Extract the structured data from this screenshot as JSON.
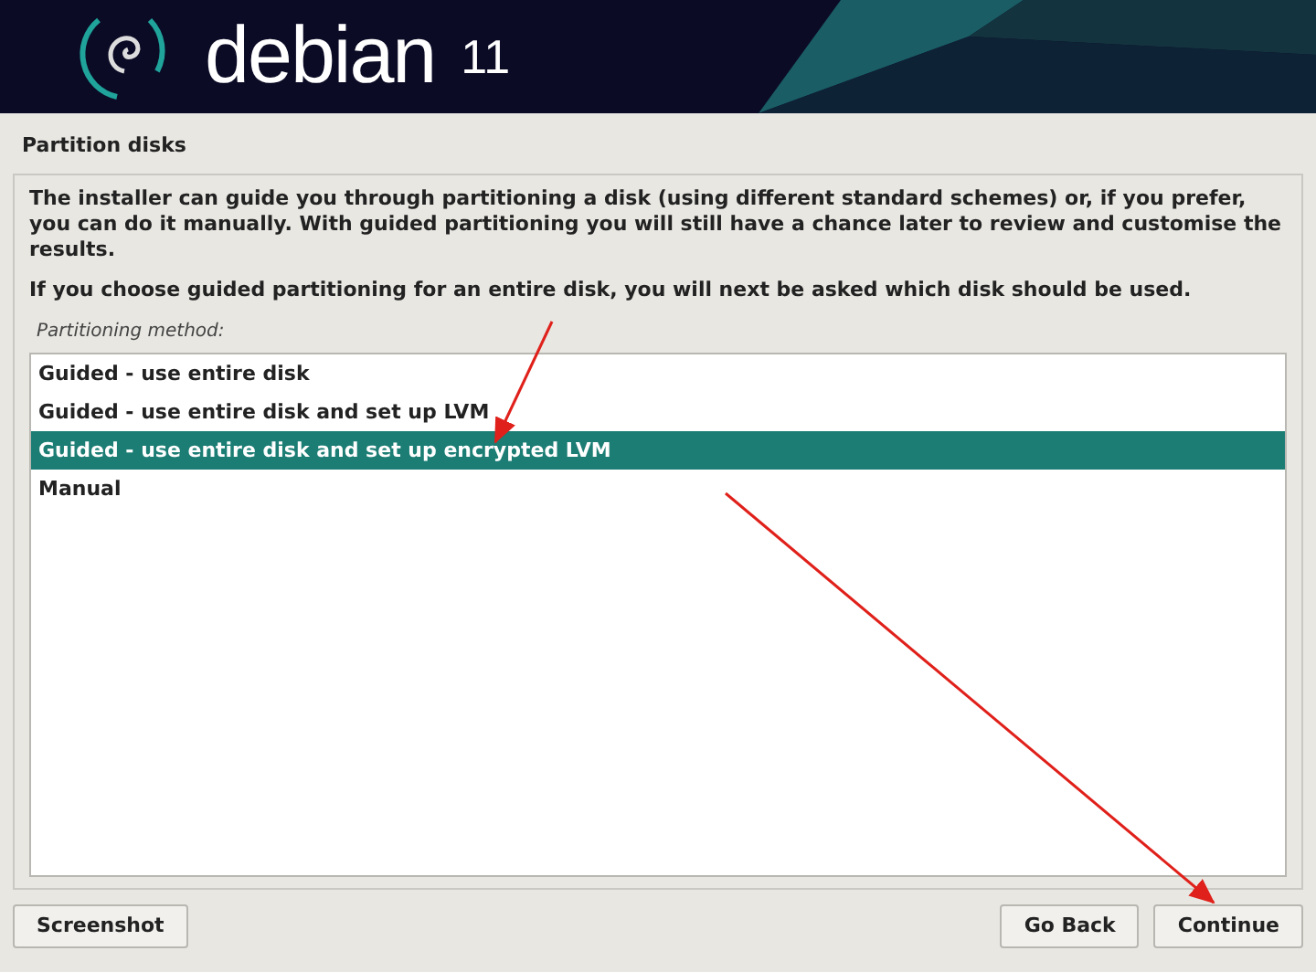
{
  "header": {
    "brand": "debian",
    "version": "11"
  },
  "title": "Partition disks",
  "description": [
    "The installer can guide you through partitioning a disk (using different standard schemes) or, if you prefer, you can do it manually. With guided partitioning you will still have a chance later to review and customise the results.",
    "If you choose guided partitioning for an entire disk, you will next be asked which disk should be used."
  ],
  "list_label": "Partitioning method:",
  "options": [
    {
      "label": "Guided - use entire disk",
      "selected": false
    },
    {
      "label": "Guided - use entire disk and set up LVM",
      "selected": false
    },
    {
      "label": "Guided - use entire disk and set up encrypted LVM",
      "selected": true
    },
    {
      "label": "Manual",
      "selected": false
    }
  ],
  "buttons": {
    "left": [
      "Screenshot"
    ],
    "right": [
      "Go Back",
      "Continue"
    ]
  }
}
